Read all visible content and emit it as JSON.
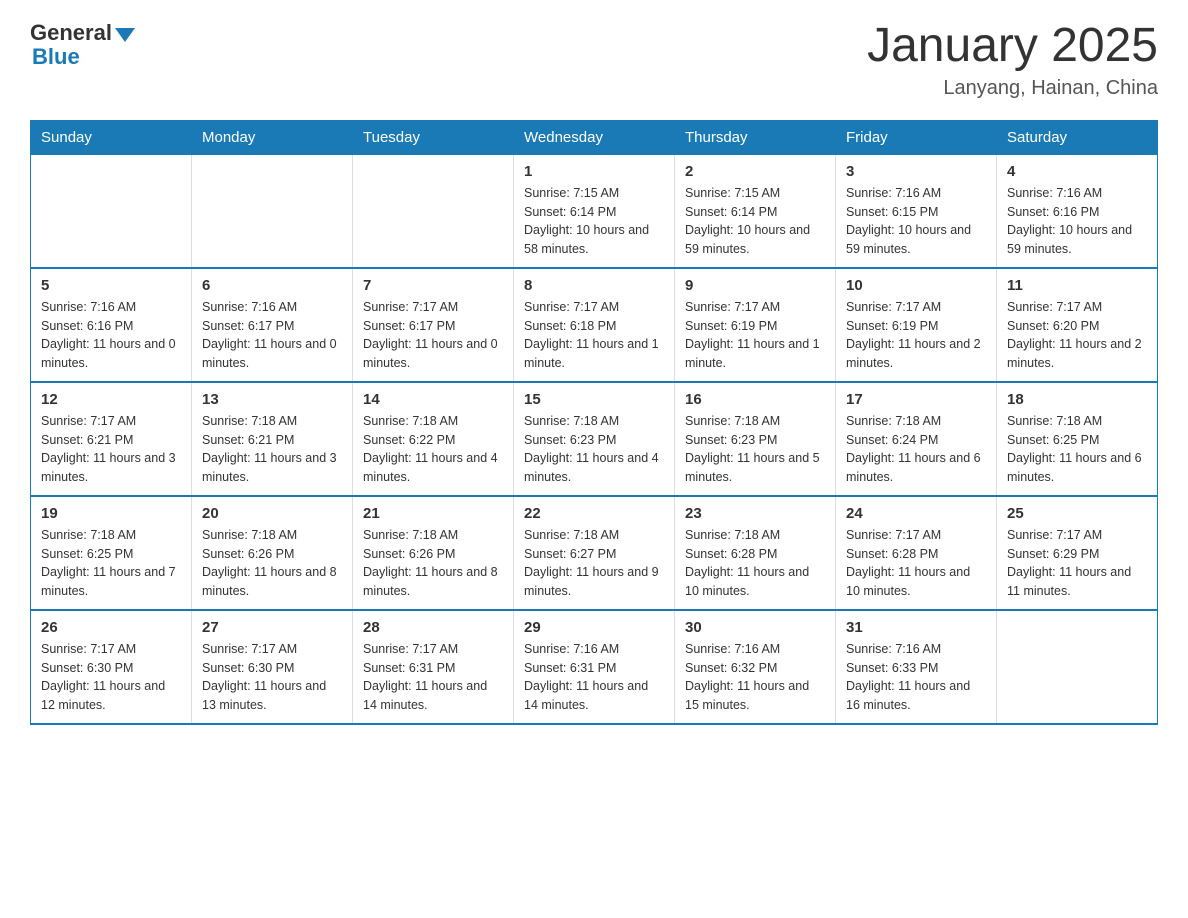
{
  "header": {
    "logo_general": "General",
    "logo_blue": "Blue",
    "title": "January 2025",
    "subtitle": "Lanyang, Hainan, China"
  },
  "days_of_week": [
    "Sunday",
    "Monday",
    "Tuesday",
    "Wednesday",
    "Thursday",
    "Friday",
    "Saturday"
  ],
  "weeks": [
    [
      {
        "day": "",
        "info": ""
      },
      {
        "day": "",
        "info": ""
      },
      {
        "day": "",
        "info": ""
      },
      {
        "day": "1",
        "info": "Sunrise: 7:15 AM\nSunset: 6:14 PM\nDaylight: 10 hours and 58 minutes."
      },
      {
        "day": "2",
        "info": "Sunrise: 7:15 AM\nSunset: 6:14 PM\nDaylight: 10 hours and 59 minutes."
      },
      {
        "day": "3",
        "info": "Sunrise: 7:16 AM\nSunset: 6:15 PM\nDaylight: 10 hours and 59 minutes."
      },
      {
        "day": "4",
        "info": "Sunrise: 7:16 AM\nSunset: 6:16 PM\nDaylight: 10 hours and 59 minutes."
      }
    ],
    [
      {
        "day": "5",
        "info": "Sunrise: 7:16 AM\nSunset: 6:16 PM\nDaylight: 11 hours and 0 minutes."
      },
      {
        "day": "6",
        "info": "Sunrise: 7:16 AM\nSunset: 6:17 PM\nDaylight: 11 hours and 0 minutes."
      },
      {
        "day": "7",
        "info": "Sunrise: 7:17 AM\nSunset: 6:17 PM\nDaylight: 11 hours and 0 minutes."
      },
      {
        "day": "8",
        "info": "Sunrise: 7:17 AM\nSunset: 6:18 PM\nDaylight: 11 hours and 1 minute."
      },
      {
        "day": "9",
        "info": "Sunrise: 7:17 AM\nSunset: 6:19 PM\nDaylight: 11 hours and 1 minute."
      },
      {
        "day": "10",
        "info": "Sunrise: 7:17 AM\nSunset: 6:19 PM\nDaylight: 11 hours and 2 minutes."
      },
      {
        "day": "11",
        "info": "Sunrise: 7:17 AM\nSunset: 6:20 PM\nDaylight: 11 hours and 2 minutes."
      }
    ],
    [
      {
        "day": "12",
        "info": "Sunrise: 7:17 AM\nSunset: 6:21 PM\nDaylight: 11 hours and 3 minutes."
      },
      {
        "day": "13",
        "info": "Sunrise: 7:18 AM\nSunset: 6:21 PM\nDaylight: 11 hours and 3 minutes."
      },
      {
        "day": "14",
        "info": "Sunrise: 7:18 AM\nSunset: 6:22 PM\nDaylight: 11 hours and 4 minutes."
      },
      {
        "day": "15",
        "info": "Sunrise: 7:18 AM\nSunset: 6:23 PM\nDaylight: 11 hours and 4 minutes."
      },
      {
        "day": "16",
        "info": "Sunrise: 7:18 AM\nSunset: 6:23 PM\nDaylight: 11 hours and 5 minutes."
      },
      {
        "day": "17",
        "info": "Sunrise: 7:18 AM\nSunset: 6:24 PM\nDaylight: 11 hours and 6 minutes."
      },
      {
        "day": "18",
        "info": "Sunrise: 7:18 AM\nSunset: 6:25 PM\nDaylight: 11 hours and 6 minutes."
      }
    ],
    [
      {
        "day": "19",
        "info": "Sunrise: 7:18 AM\nSunset: 6:25 PM\nDaylight: 11 hours and 7 minutes."
      },
      {
        "day": "20",
        "info": "Sunrise: 7:18 AM\nSunset: 6:26 PM\nDaylight: 11 hours and 8 minutes."
      },
      {
        "day": "21",
        "info": "Sunrise: 7:18 AM\nSunset: 6:26 PM\nDaylight: 11 hours and 8 minutes."
      },
      {
        "day": "22",
        "info": "Sunrise: 7:18 AM\nSunset: 6:27 PM\nDaylight: 11 hours and 9 minutes."
      },
      {
        "day": "23",
        "info": "Sunrise: 7:18 AM\nSunset: 6:28 PM\nDaylight: 11 hours and 10 minutes."
      },
      {
        "day": "24",
        "info": "Sunrise: 7:17 AM\nSunset: 6:28 PM\nDaylight: 11 hours and 10 minutes."
      },
      {
        "day": "25",
        "info": "Sunrise: 7:17 AM\nSunset: 6:29 PM\nDaylight: 11 hours and 11 minutes."
      }
    ],
    [
      {
        "day": "26",
        "info": "Sunrise: 7:17 AM\nSunset: 6:30 PM\nDaylight: 11 hours and 12 minutes."
      },
      {
        "day": "27",
        "info": "Sunrise: 7:17 AM\nSunset: 6:30 PM\nDaylight: 11 hours and 13 minutes."
      },
      {
        "day": "28",
        "info": "Sunrise: 7:17 AM\nSunset: 6:31 PM\nDaylight: 11 hours and 14 minutes."
      },
      {
        "day": "29",
        "info": "Sunrise: 7:16 AM\nSunset: 6:31 PM\nDaylight: 11 hours and 14 minutes."
      },
      {
        "day": "30",
        "info": "Sunrise: 7:16 AM\nSunset: 6:32 PM\nDaylight: 11 hours and 15 minutes."
      },
      {
        "day": "31",
        "info": "Sunrise: 7:16 AM\nSunset: 6:33 PM\nDaylight: 11 hours and 16 minutes."
      },
      {
        "day": "",
        "info": ""
      }
    ]
  ]
}
